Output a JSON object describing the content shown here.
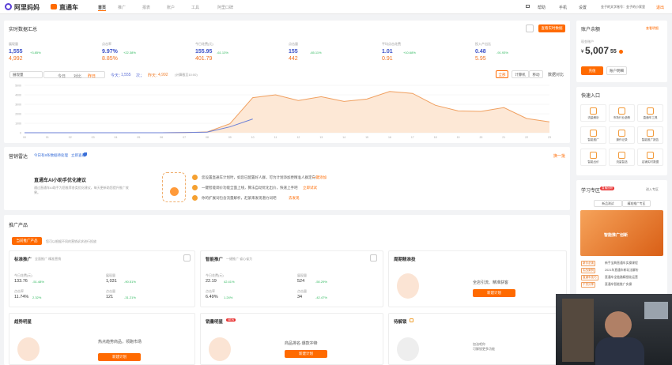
{
  "brand": {
    "logo1": "阿里妈妈",
    "logo2": "直通车"
  },
  "nav": [
    "首页",
    "推广",
    "报表",
    "账户",
    "工具",
    "阿里口碑"
  ],
  "topright": {
    "msg": "",
    "help": "帮助",
    "phone": "手机",
    "settings": "设置",
    "account": "金子的文字账号：金子的小家里",
    "logout": "退出"
  },
  "overview": {
    "title": "实时数据汇总",
    "btn": "查看实时数据",
    "metrics": [
      {
        "label": "展现量",
        "v1": "1,555",
        "delta": "+3.85%",
        "v2": "4,992"
      },
      {
        "label": "点击率",
        "v1": "9.97%",
        "delta": "+22.38%",
        "v2": "8.85%"
      },
      {
        "label": "今日花费(元)",
        "v1": "155.95",
        "delta": "-61.13%",
        "v2": "401.79"
      },
      {
        "label": "点击量",
        "v1": "155",
        "delta": "-65.11%",
        "v2": "442"
      },
      {
        "label": "平均点击花费",
        "v1": "1.01",
        "delta": "+10.68%",
        "v2": "0.91"
      },
      {
        "label": "投入产出比",
        "v1": "0.48",
        "delta": "-91.93%",
        "v2": "5.95"
      }
    ],
    "select": "展现量",
    "dates": [
      "今日",
      "对比",
      "昨日"
    ],
    "today_label": "今天：",
    "today_val": "1,555",
    "unit": "次；",
    "yest_label": "昨天：",
    "yest_val": "4,992",
    "note": "(计算截至10:00)",
    "filters": [
      "全部",
      "计算机",
      "移动"
    ],
    "compare": "数据对比"
  },
  "chart_data": {
    "type": "line",
    "x": [
      "00",
      "01",
      "02",
      "03",
      "04",
      "05",
      "06",
      "07",
      "08",
      "09",
      "10",
      "11",
      "12",
      "13",
      "14",
      "15",
      "16",
      "17",
      "18",
      "19",
      "20",
      "21",
      "22",
      "23"
    ],
    "ylim": [
      0,
      5000
    ],
    "yticks": [
      "5000",
      "4000",
      "3000",
      "2000",
      "1000",
      "0"
    ],
    "series": [
      {
        "values": [
          0,
          0,
          0,
          0,
          0,
          0,
          0,
          20,
          80,
          950,
          3700,
          4000,
          3400,
          3800,
          3300,
          3550,
          4350,
          4150,
          2900,
          2300,
          2250,
          2650,
          1500,
          1150
        ],
        "color": "#f0a060"
      },
      {
        "values": [
          0,
          0,
          0,
          0,
          0,
          0,
          0,
          20,
          60,
          620,
          1450
        ],
        "color": "#6b7fd7"
      }
    ]
  },
  "promo": {
    "title": "营销雷达",
    "sub": "今日有8条数据待处理",
    "link": "立即查看",
    "ai": "直通车AI小助手优化建议",
    "ai_desc": "通过直通车AI助手为您推荐各类优化建议，每天更新助您提升推广效果。",
    "tips": [
      {
        "text": "您设置直通车计划时，如您已配置好人群，可为计划添加更精准人群定向",
        "link": "一键添加"
      },
      {
        "text": "一键智能调价功能全面上线，算法自动优化出价，快速上手吧",
        "link": "立即试试"
      },
      {
        "text": "你的扩展词包含流量解析，赶紧来发现潜力词吧",
        "link": "去发现"
      }
    ],
    "right": "换一批"
  },
  "products": {
    "title": "推广产品",
    "active_tab": "当前推广产品",
    "tab_note": "您可以根据不同的营销诉求进行投放",
    "cards": [
      {
        "title": "标准推广",
        "sub": "全面推广 精准营销",
        "stats": [
          [
            "今日花费(元)",
            "133.76",
            "-51.48%"
          ],
          [
            "展现量",
            "1,031",
            "-90.51%"
          ],
          [
            "点击率",
            "11.74%",
            "2.32%"
          ],
          [
            "点击量",
            "121",
            "-31.21%"
          ]
        ]
      },
      {
        "title": "智能推广",
        "sub": "一键推广 省心省力",
        "stats": [
          [
            "今日花费(元)",
            "22.19",
            "42.41%"
          ],
          [
            "展现量",
            "524",
            "-50.29%"
          ],
          [
            "点击率",
            "6.49%",
            "1.24%"
          ],
          [
            "点击量",
            "34",
            "-42.47%"
          ]
        ]
      },
      {
        "title": "周期精准投",
        "desc1": "全店引流、精准获客",
        "btn": "新建计划"
      }
    ],
    "row2": [
      {
        "title": "趋势明星",
        "desc": "热点趋势商品，领跑市场",
        "btn": "新建计划"
      },
      {
        "title": "销量明星",
        "badge": "NEW",
        "desc": "商品排名·爆款冲锋",
        "btn": "新建计划"
      },
      {
        "title": "待解锁",
        "desc": "加油吧你\n可解锁更多功能"
      }
    ]
  },
  "account": {
    "title": "账户余额",
    "link": "查看明细",
    "sub": "现金账户",
    "amount": "5,007",
    "cents": "55",
    "btn1": "充值",
    "btn2": "账户明细"
  },
  "quick": {
    "title": "快速入口",
    "items": [
      "流量解析",
      "市场行业趋势",
      "直通车工具",
      "智能推广",
      "操作记录",
      "智能推广报告",
      "智能出价",
      "流量智选",
      "店铺实时数据"
    ]
  },
  "learn": {
    "title": "学习专区",
    "badge": "直播回顾",
    "more": "进入专区",
    "tabs": [
      "新品测试",
      "精准推广专区"
    ],
    "banner": "智能推广创新",
    "items": [
      "新手宝典直通车实操课程",
      "2021年直通车新玩法解析",
      "直通车全链路精细化运营",
      "直通车智能推广实操"
    ],
    "tags": [
      "新手必读",
      "实战案例",
      "直通车技巧",
      "干货分享"
    ]
  }
}
